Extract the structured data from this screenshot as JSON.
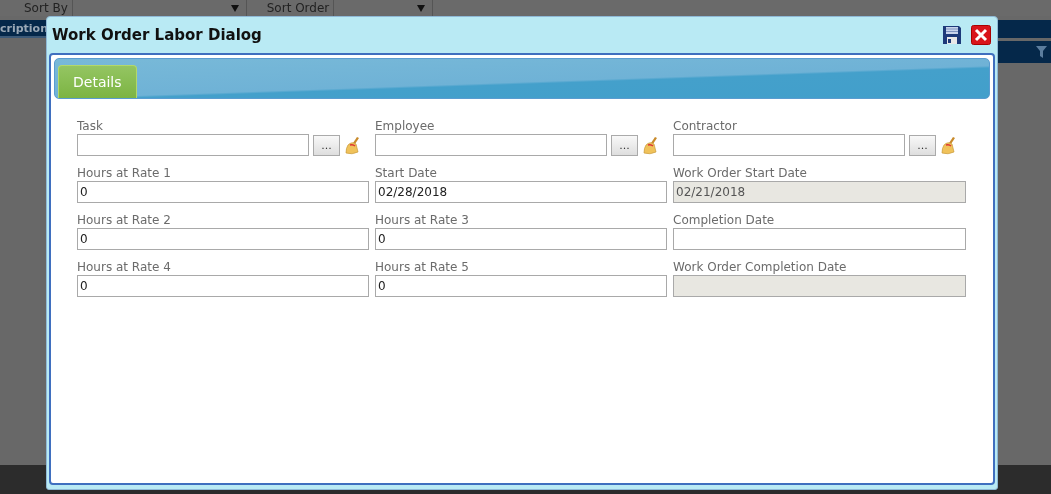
{
  "background": {
    "sort_by_label": "Sort By",
    "sort_order_label": "Sort Order",
    "column_header": "cription"
  },
  "dialog": {
    "title": "Work Order Labor Dialog",
    "tabs": [
      {
        "label": "Details",
        "selected": true
      }
    ],
    "fields": [
      {
        "label": "Task",
        "kind": "lookup",
        "button_label": "...",
        "disabled": false
      },
      {
        "label": "Employee",
        "kind": "lookup",
        "button_label": "...",
        "disabled": false
      },
      {
        "label": "Contractor",
        "kind": "lookup",
        "button_label": "...",
        "disabled": false
      },
      {
        "label": "Hours at Rate 1",
        "kind": "text",
        "value": "0",
        "disabled": false
      },
      {
        "label": "Start Date",
        "kind": "text",
        "value": "02/28/2018",
        "disabled": false
      },
      {
        "label": "Work Order Start Date",
        "kind": "text",
        "value": "02/21/2018",
        "disabled": true
      },
      {
        "label": "Hours at Rate 2",
        "kind": "text",
        "value": "0",
        "disabled": false
      },
      {
        "label": "Hours at Rate 3",
        "kind": "text",
        "value": "0",
        "disabled": false
      },
      {
        "label": "Completion Date",
        "kind": "text",
        "disabled": false
      },
      {
        "label": "Hours at Rate 4",
        "kind": "text",
        "value": "0",
        "disabled": false
      },
      {
        "label": "Hours at Rate 5",
        "kind": "text",
        "value": "0",
        "disabled": false
      },
      {
        "label": "Work Order Completion Date",
        "kind": "text",
        "disabled": true
      }
    ]
  }
}
